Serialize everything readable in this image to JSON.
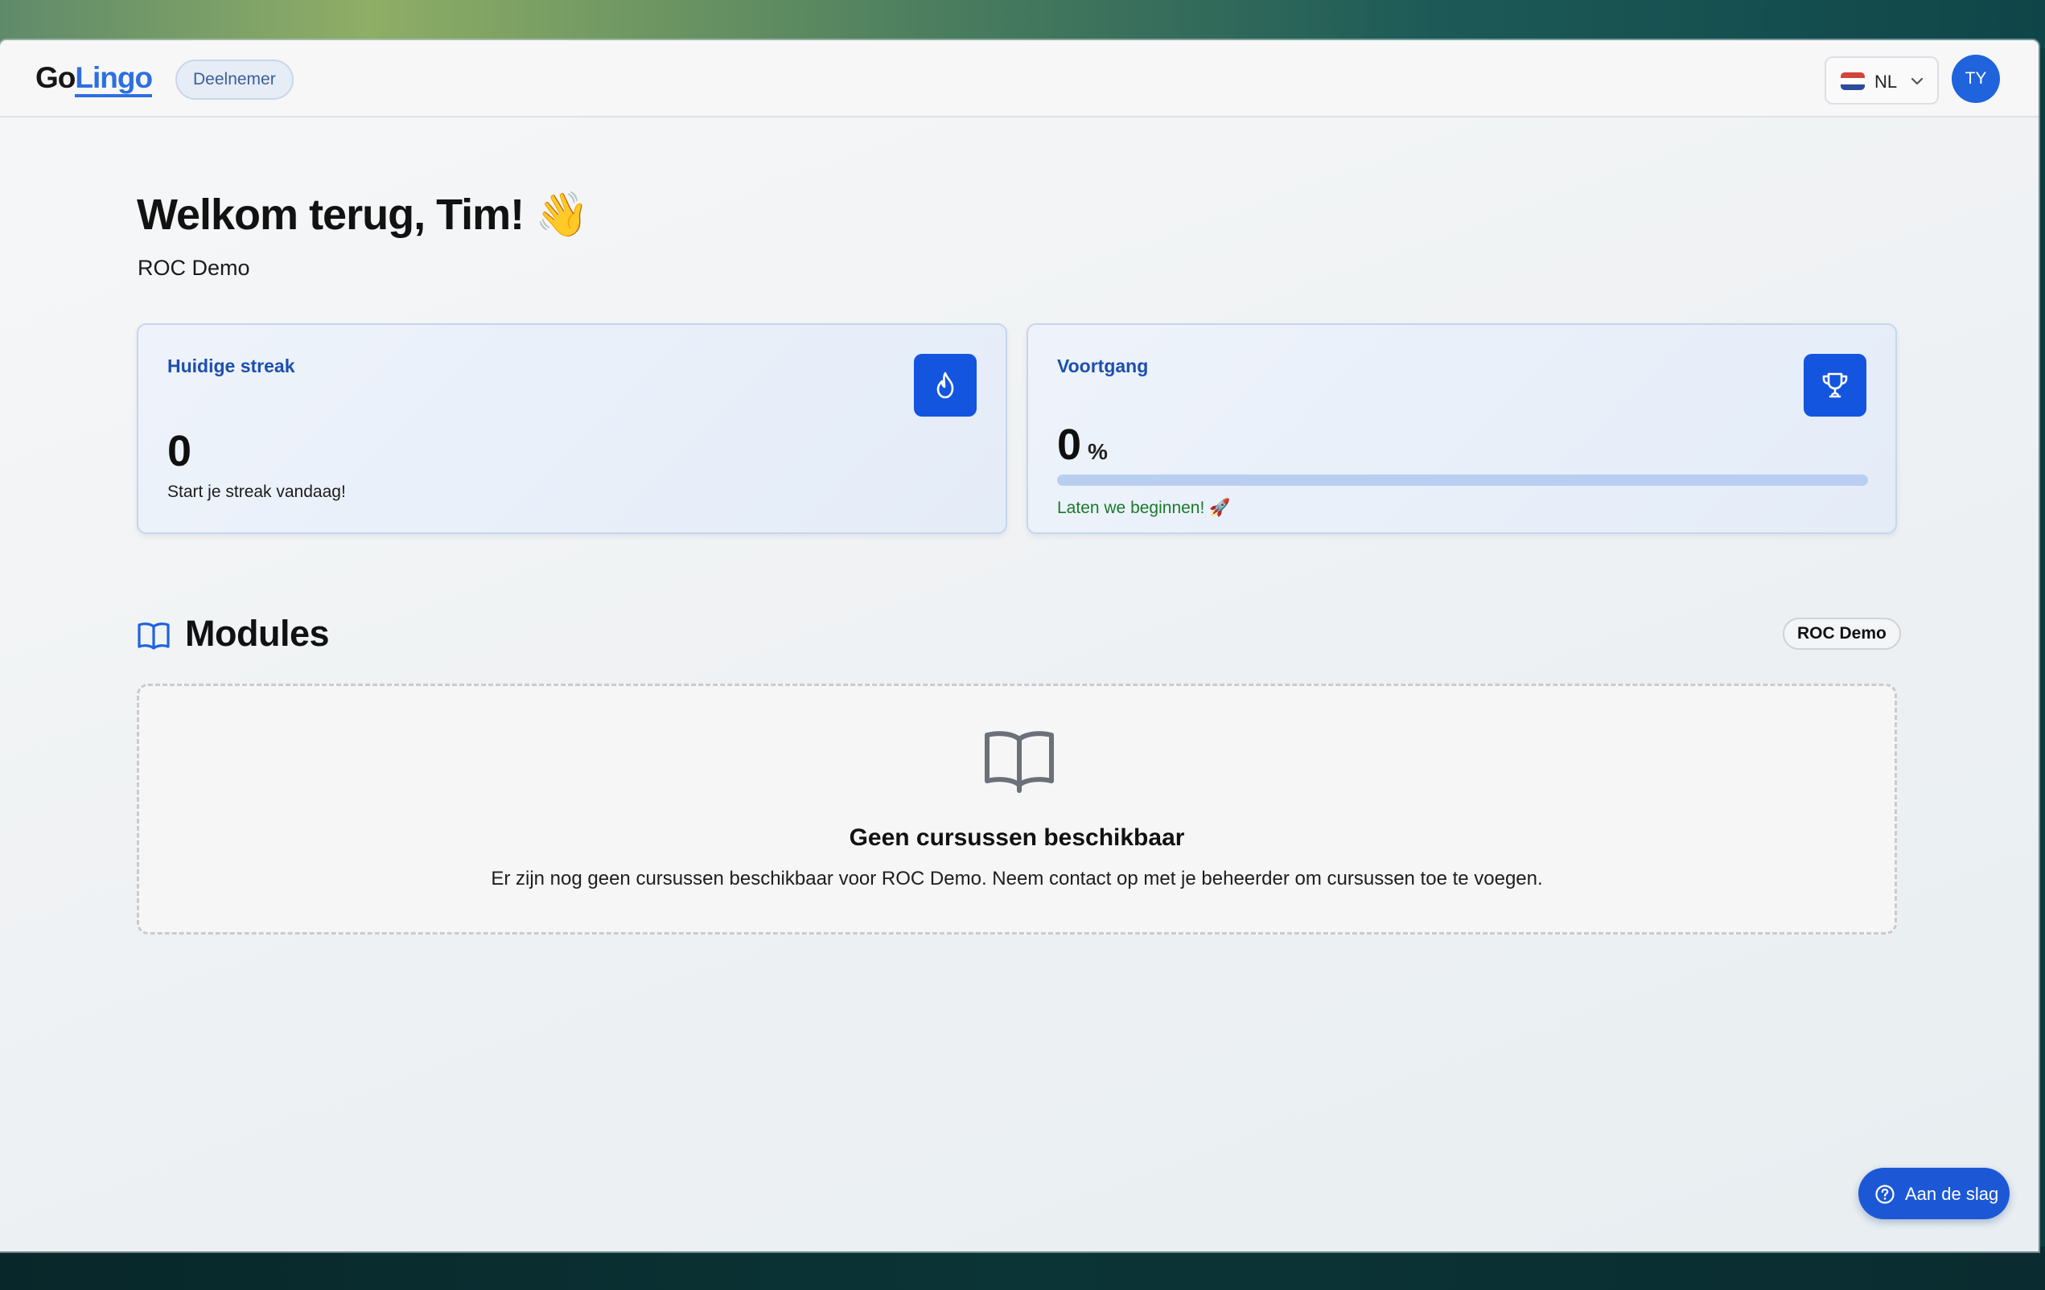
{
  "header": {
    "logo_prefix": "Go",
    "logo_accent": "Lingo",
    "role_badge": "Deelnemer",
    "language": "NL",
    "avatar_initials": "TY"
  },
  "welcome": {
    "title": "Welkom terug, Tim! 👋",
    "organization": "ROC Demo"
  },
  "streak_card": {
    "title": "Huidige streak",
    "value": "0",
    "subtitle": "Start je streak vandaag!",
    "icon": "flame-icon"
  },
  "progress_card": {
    "title": "Voortgang",
    "value": "0",
    "unit": "%",
    "progress_fraction": 0,
    "message": "Laten we beginnen! 🚀",
    "icon": "trophy-icon"
  },
  "modules": {
    "title": "Modules",
    "org_pill": "ROC Demo",
    "empty_title": "Geen cursussen beschikbaar",
    "empty_description": "Er zijn nog geen cursussen beschikbaar voor ROC Demo. Neem contact op met je beheerder om cursussen toe te voegen."
  },
  "help_button": {
    "label": "Aan de slag"
  },
  "colors": {
    "primary": "#1355df",
    "progress_text": "#1a7a2b",
    "card_title": "#1d4fae"
  }
}
